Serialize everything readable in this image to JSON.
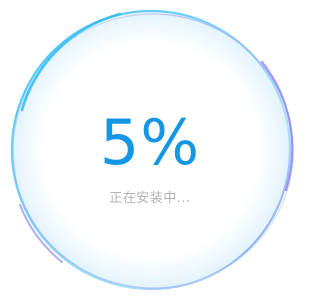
{
  "progress": {
    "percent_label": "5%",
    "percent_value": 5,
    "status_text": "正在安装中..."
  },
  "colors": {
    "accent": "#1596e4",
    "ring_cyan": "#4cc7f5",
    "ring_violet": "#8b86f0",
    "status_gray": "#b3b3b3"
  }
}
